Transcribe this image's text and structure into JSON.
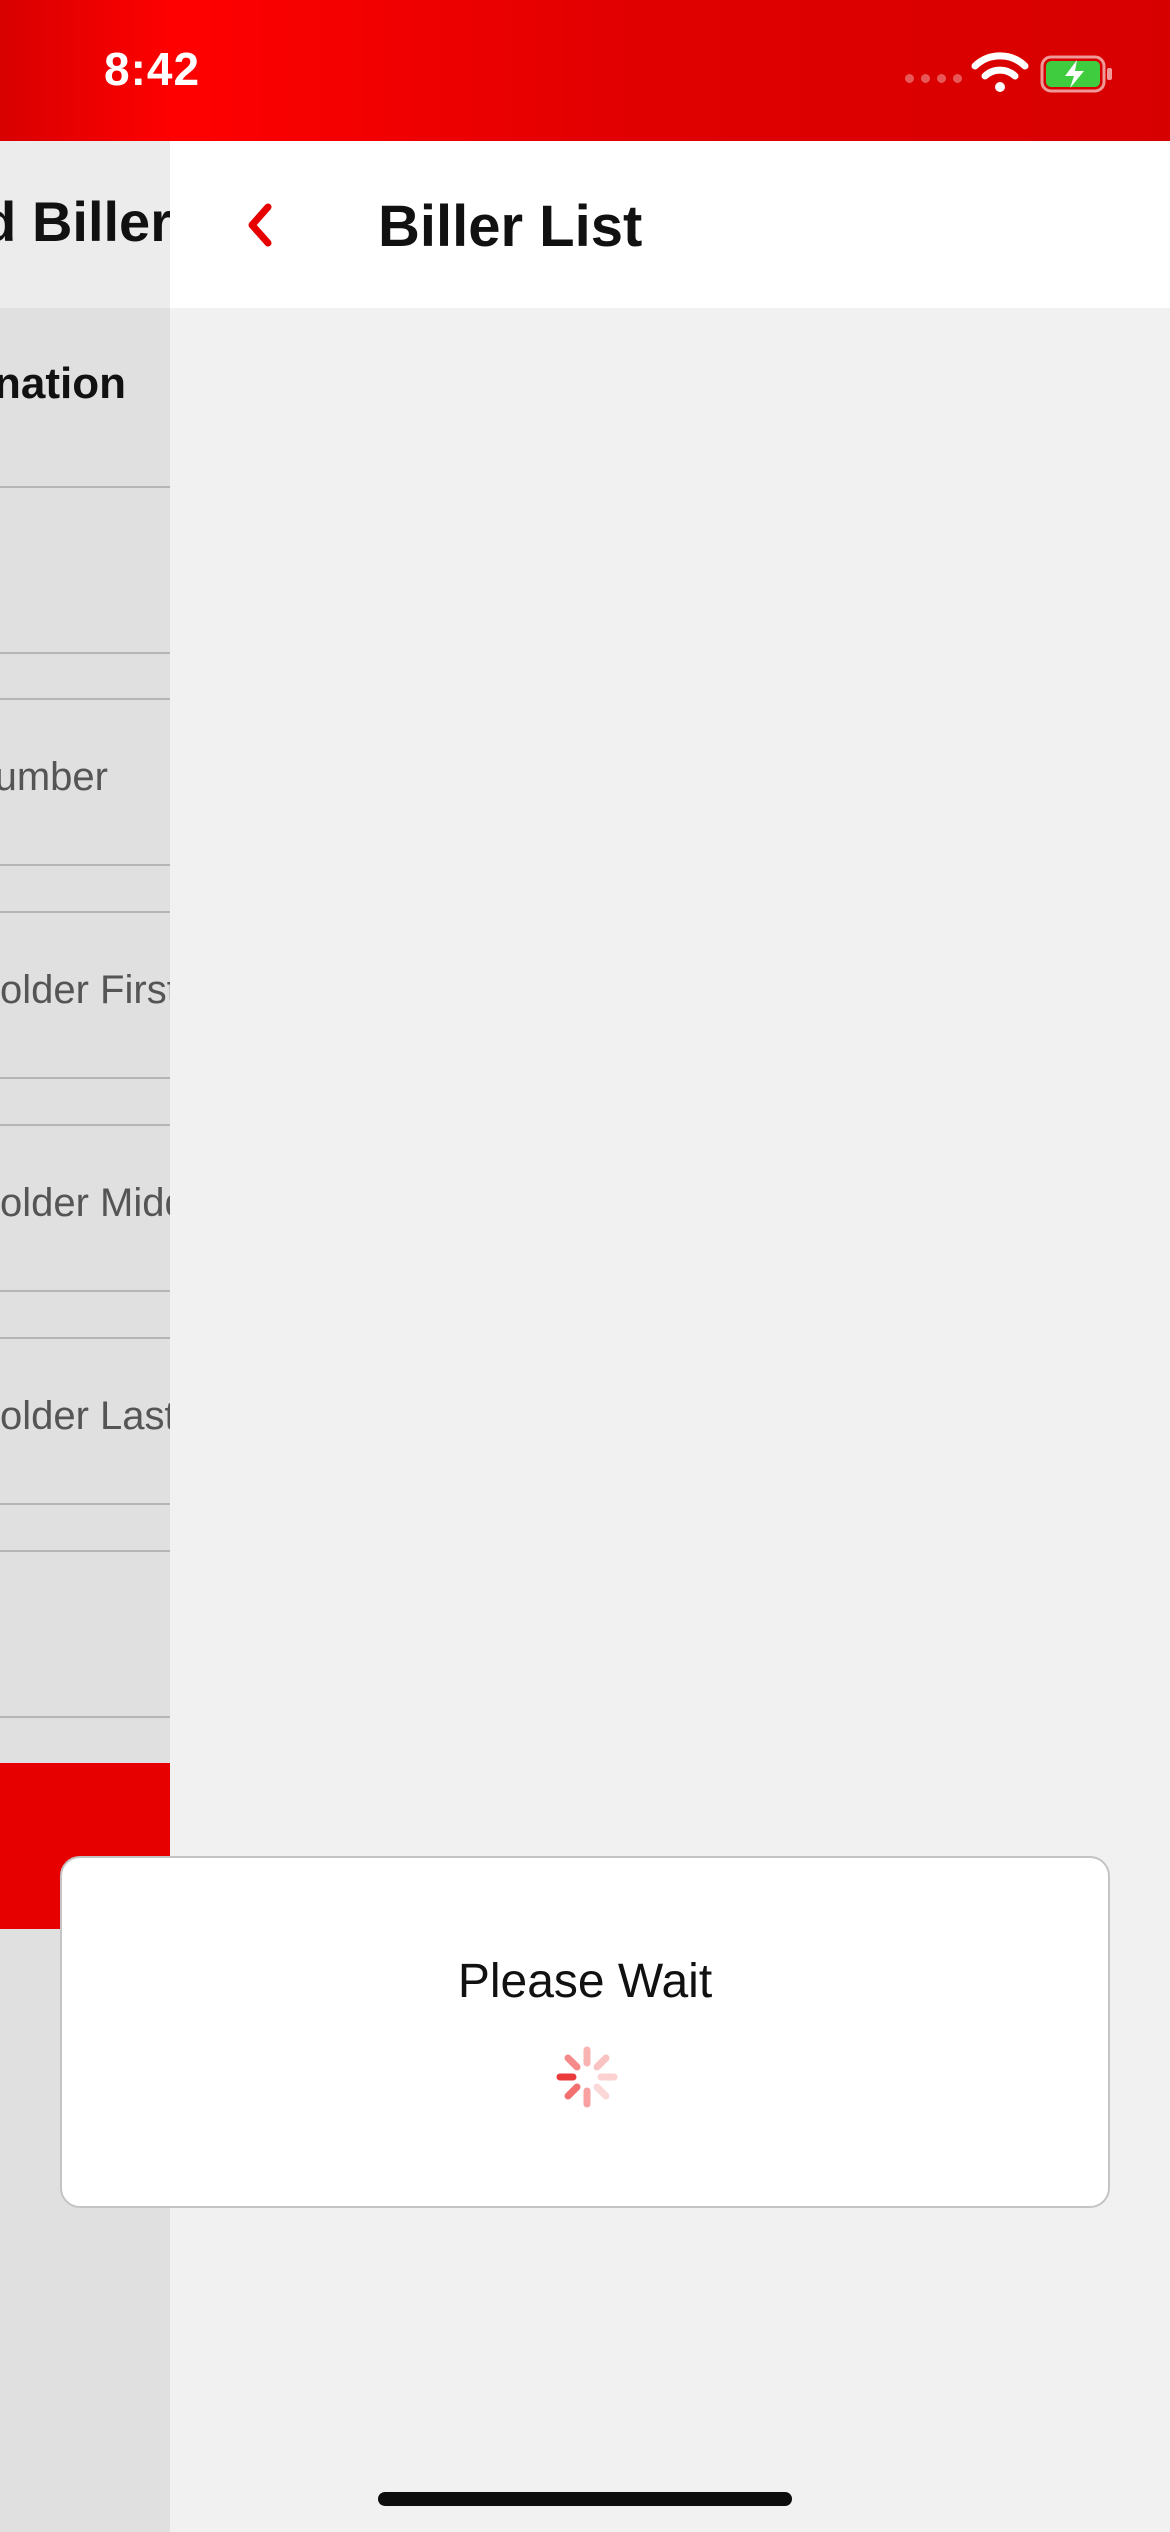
{
  "status_bar": {
    "time": "8:42"
  },
  "background_screen": {
    "header_title": "d Biller",
    "section_title": "nation",
    "fields": [
      "",
      "umber",
      "older First",
      "older Middle",
      "older Last",
      ""
    ]
  },
  "main": {
    "header_title": "Biller List"
  },
  "modal": {
    "message": "Please Wait"
  },
  "colors": {
    "accent": "#e60000",
    "background": "#f1f1f1",
    "battery_fill": "#3fcd3f"
  }
}
